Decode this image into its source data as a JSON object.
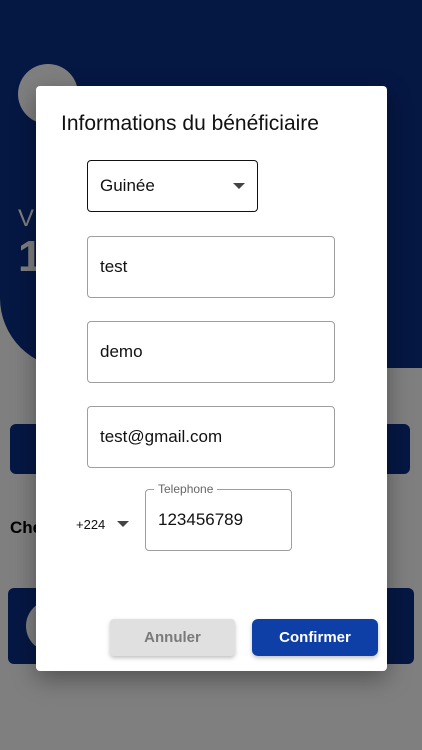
{
  "background": {
    "label": "V",
    "amount": "1",
    "section_title": "Che"
  },
  "dialog": {
    "title": "Informations du bénéficiaire",
    "country_select": {
      "value": "Guinée"
    },
    "fields": [
      {
        "value": "test"
      },
      {
        "value": "demo"
      },
      {
        "value": "test@gmail.com"
      }
    ],
    "phone": {
      "country_code": "+224",
      "label": "Telephone",
      "value": "123456789"
    },
    "buttons": {
      "cancel_label": "Annuler",
      "confirm_label": "Confirmer"
    }
  },
  "colors": {
    "brand": "#0b2f86",
    "confirm": "#0d3fa6",
    "cancel_bg": "#e0e0e0"
  },
  "icons": {
    "dropdown": "caret-down-icon"
  }
}
